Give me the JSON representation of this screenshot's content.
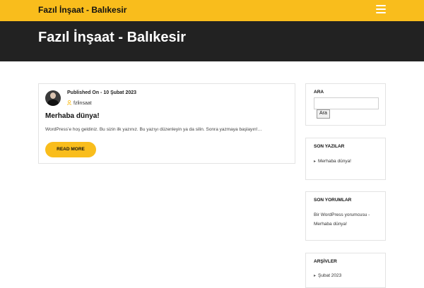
{
  "header": {
    "site_title": "Fazıl İnşaat - Balıkesir",
    "menu_icon": "hamburger-menu-icon"
  },
  "banner": {
    "title": "Fazıl İnşaat - Balıkesir"
  },
  "post": {
    "published_label": "Published On - 10 Şubat 2023",
    "author": "fzlinsaat",
    "title": "Merhaba dünya!",
    "excerpt": "WordPress’e hoş geldiniz. Bu sizin ilk yazınız. Bu yazıyı düzenleyin ya da silin. Sonra yazmaya başlayın!…",
    "read_more_label": "READ MORE"
  },
  "sidebar": {
    "search": {
      "title": "ARA",
      "value": "",
      "button_label": "Ara"
    },
    "recent_posts": {
      "title": "SON YAZILAR",
      "items": [
        "Merhaba dünya!"
      ]
    },
    "recent_comments": {
      "title": "SON YORUMLAR",
      "author": "Bir WordPress yorumcusu",
      "separator": " - ",
      "post": "Merhaba dünya!"
    },
    "archives": {
      "title": "ARŞİVLER",
      "items": [
        "Şubat 2023"
      ]
    }
  },
  "colors": {
    "accent": "#f9bd1c",
    "banner_bg": "#222222"
  }
}
